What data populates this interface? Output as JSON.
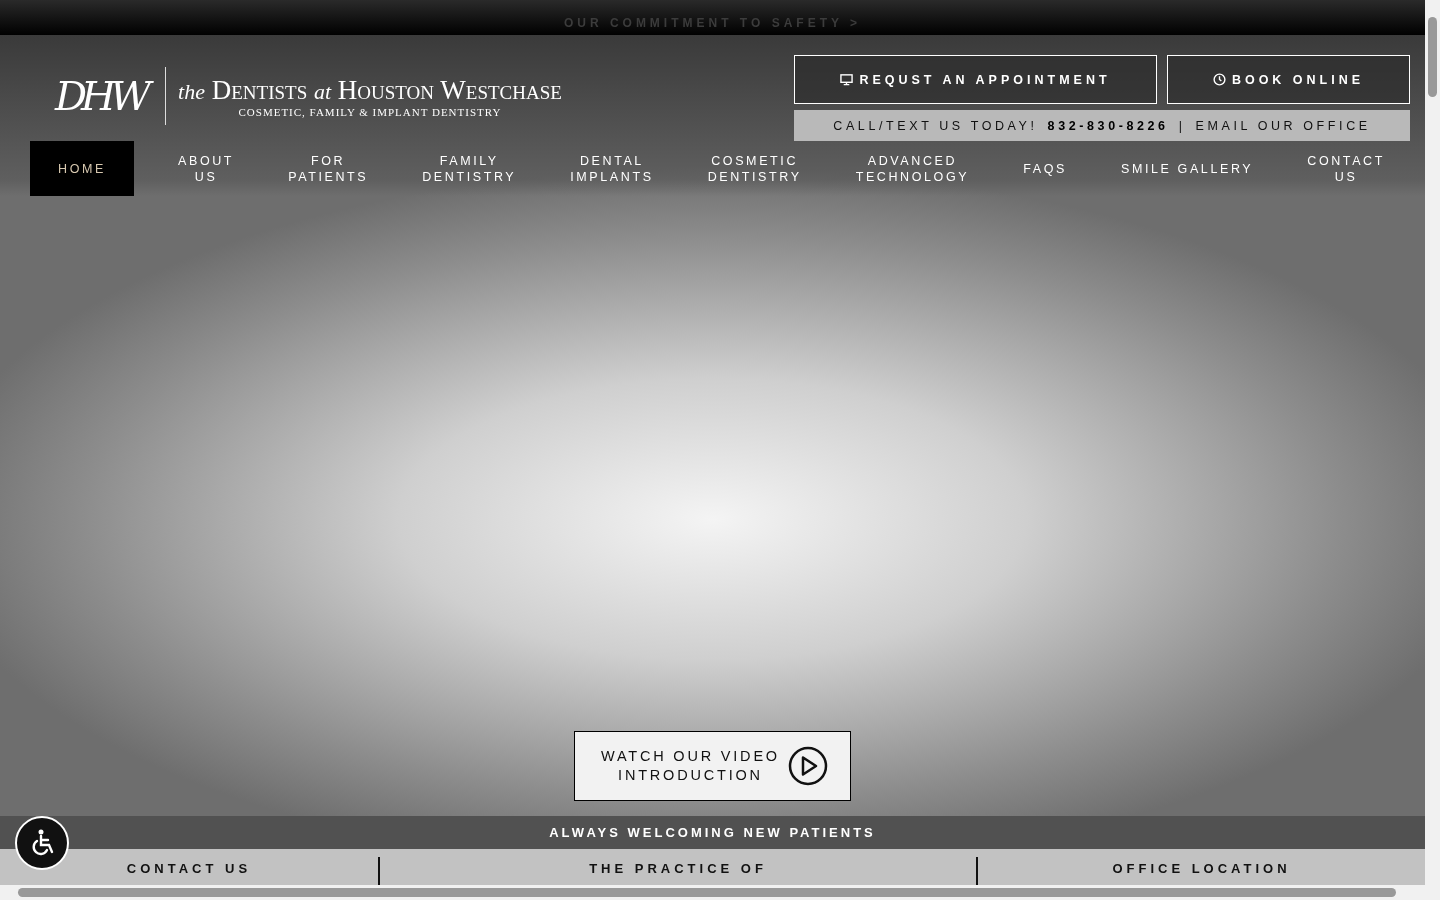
{
  "top_bar": {
    "link": "OUR COMMITMENT TO SAFETY >"
  },
  "logo": {
    "monogram": "DHW",
    "name": "*the* Dentists *at* Houston Westchase",
    "tagline": "COSMETIC, FAMILY & IMPLANT DENTISTRY"
  },
  "header_buttons": [
    {
      "label": "REQUST AN APPOINTMENT",
      "kind": "monitor"
    },
    {
      "label": "BOOK ONLINE",
      "kind": "clock"
    }
  ],
  "call_bar": {
    "text": "CALL/TEXT US TODAY!",
    "phone": "832-830-8226",
    "separator": "|",
    "email": "EMAIL OUR OFFICE"
  },
  "nav": [
    {
      "label": "HOME",
      "selected": true
    },
    {
      "label": "ABOUT\nUS",
      "selected": false
    },
    {
      "label": "FOR\nPATIENTS",
      "selected": false
    },
    {
      "label": "FAMILY\nDENTISTRY",
      "selected": false
    },
    {
      "label": "DENTAL\nIMPLANTS",
      "selected": false
    },
    {
      "label": "COSMETIC\nDENTISTRY",
      "selected": false
    },
    {
      "label": "ADVANCED\nTECHNOLOGY",
      "selected": false
    },
    {
      "label": "FAQS",
      "selected": false
    },
    {
      "label": "SMILE GALLERY",
      "selected": false
    },
    {
      "label": "CONTACT\nUS",
      "selected": false
    }
  ],
  "video_button": {
    "label": "WATCH OUR VIDEO\nINTRODUCTION"
  },
  "banner": "ALWAYS WELCOMING NEW PATIENTS",
  "footer_headings": [
    "CONTACT US",
    "THE PRACTICE OF",
    "OFFICE LOCATION"
  ]
}
